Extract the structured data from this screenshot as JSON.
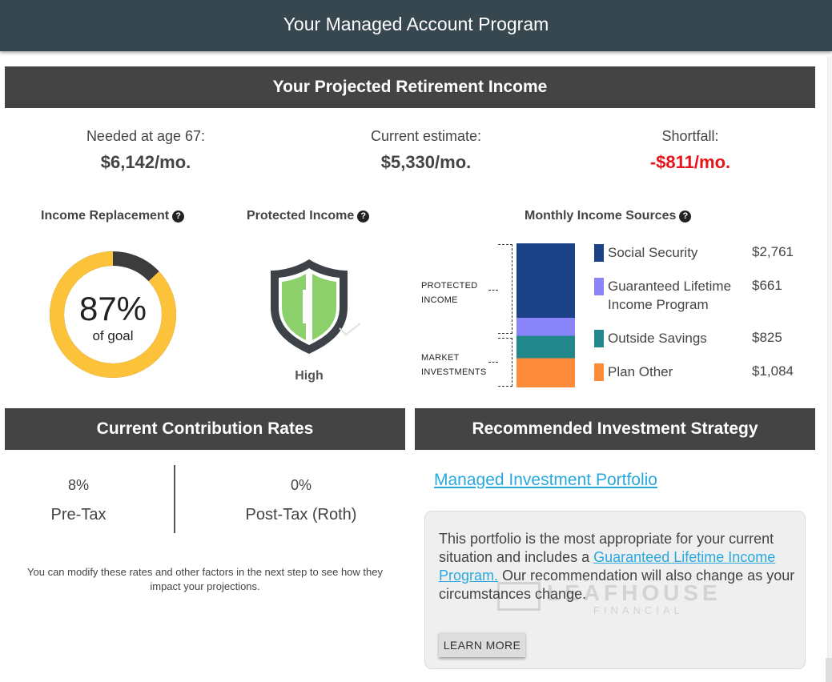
{
  "header": {
    "title": "Your Managed Account Program"
  },
  "projection": {
    "section_title": "Your Projected Retirement Income",
    "needed": {
      "label": "Needed at age 67:",
      "value": "$6,142/mo."
    },
    "current": {
      "label": "Current estimate:",
      "value": "$5,330/mo."
    },
    "shortfall": {
      "label": "Shortfall:",
      "value": "-$811/mo."
    }
  },
  "income_replacement": {
    "title": "Income Replacement",
    "percent_text": "87%",
    "percent_value": 87,
    "subtitle": "of goal",
    "colors": {
      "progress": "#fcc239",
      "remainder": "#3c3c3c"
    }
  },
  "protected_income": {
    "title": "Protected Income",
    "level": "High",
    "icon": "shield-icon",
    "colors": {
      "fill": "#8bd06a",
      "outline": "#3d4249"
    }
  },
  "monthly_sources": {
    "title": "Monthly Income Sources",
    "group_labels": {
      "protected": "PROTECTED\nINCOME",
      "market": "MARKET\nINVESTMENTS"
    },
    "items": [
      {
        "label": "Social Security",
        "value": "$2,761",
        "amount": 2761,
        "color": "#1b4186"
      },
      {
        "label": "Guaranteed Lifetime Income Program",
        "value": "$661",
        "amount": 661,
        "color": "#8a84fb"
      },
      {
        "label": "Outside Savings",
        "value": "$825",
        "amount": 825,
        "color": "#22878a"
      },
      {
        "label": "Plan Other",
        "value": "$1,084",
        "amount": 1084,
        "color": "#fc8b3a"
      }
    ]
  },
  "contribution": {
    "section_title": "Current Contribution Rates",
    "pretax": {
      "value": "8%",
      "label": "Pre-Tax"
    },
    "posttax": {
      "value": "0%",
      "label": "Post-Tax (Roth)"
    },
    "note": "You can modify these rates and other factors in the next step to see how they impact your projections."
  },
  "strategy": {
    "section_title": "Recommended Investment Strategy",
    "portfolio_link": "Managed Investment Portfolio",
    "description_before": "This portfolio is the most appropriate for your current situation and includes a ",
    "description_link": "Guaranteed Lifetime Income Program.",
    "description_after": " Our recommendation will also change as your circumstances change.",
    "learn_more": "LEARN MORE",
    "watermark": {
      "brand": "LEAFHOUSE",
      "sub": "FINANCIAL"
    }
  },
  "colors": {
    "header_bg": "#37474f",
    "section_bar": "#444444",
    "link": "#29a8e0",
    "negative": "#e8141b"
  }
}
